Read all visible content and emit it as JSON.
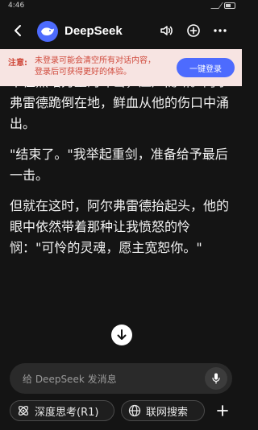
{
  "status": {
    "time": "4:46"
  },
  "header": {
    "title": "DeepSeek",
    "icons": [
      "back-icon",
      "deepseek-logo",
      "speaker-icon",
      "new-chat-icon",
      "more-icon"
    ]
  },
  "notice": {
    "label": "注意:",
    "text": "未登录可能会清空所有对话内容，登录后可获得更好的体验。",
    "button": "一键登录"
  },
  "message": {
    "paragraphs": [
      "不住黑暗力量的冲击，应声而断。阿尔弗雷德跪倒在地，鲜血从他的伤口中涌出。",
      "\"结束了。\"我举起重剑，准备给予最后一击。",
      "但就在这时，阿尔弗雷德抬起头，他的眼中依然带着那种让我愤怒的怜悯：\"可怜的灵魂，愿主宽恕你。\""
    ]
  },
  "composer": {
    "placeholder": "给 DeepSeek 发消息"
  },
  "toggles": {
    "deep_think": "深度思考(R1)",
    "web_search": "联网搜索"
  },
  "colors": {
    "accent": "#4d6bfe",
    "notice_bg": "#f7e4e2",
    "notice_text": "#d04a3c",
    "background": "#141414"
  }
}
